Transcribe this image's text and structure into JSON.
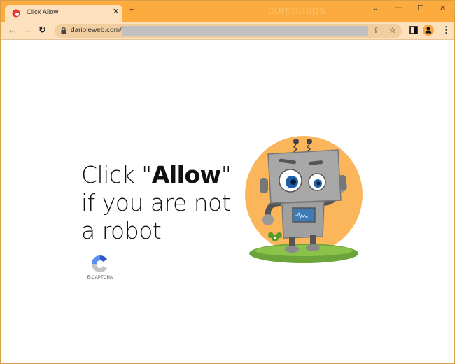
{
  "browser": {
    "tab": {
      "title": "Click Allow",
      "close_glyph": "✕",
      "favicon": "red-circle-favicon"
    },
    "new_tab_glyph": "+",
    "watermark": "computips",
    "window_controls": {
      "dropdown": "⌄",
      "minimize": "—",
      "maximize": "☐",
      "close": "✕"
    },
    "nav": {
      "back": "←",
      "forward": "→",
      "reload": "↻"
    },
    "address": {
      "url": "darioleweb.com/",
      "share_glyph": "⇪",
      "bookmark_glyph": "☆"
    },
    "menu_glyph": "⋮"
  },
  "page": {
    "headline": {
      "pre": "Click \"",
      "bold": "Allow",
      "post": "\" if you are not a robot"
    },
    "captcha_label": "E-CAPTCHA",
    "colors": {
      "chrome_orange": "#fcab3f",
      "toolbar": "#fde1bd",
      "sun": "#fbb55a",
      "grass": "#6aa43a"
    }
  }
}
